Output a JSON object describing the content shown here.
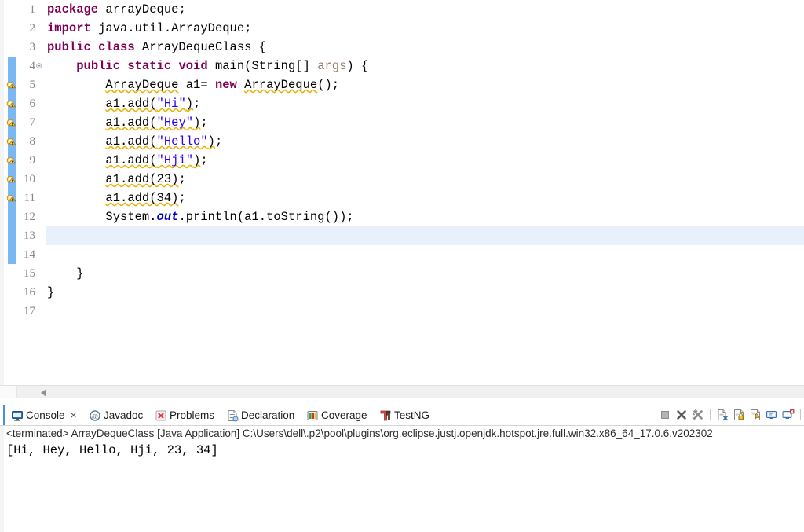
{
  "editor": {
    "name": "java-source-editor",
    "current_line": 13,
    "change_bar_color": "#4da0f0",
    "current_line_highlight": "#e8f0fb",
    "keyword_color": "#7f0055",
    "string_color": "#2a00ff",
    "warning_underline_color": "#e8b000",
    "total_lines": 17,
    "lines": [
      {
        "num": "1",
        "warning": false,
        "fold": false,
        "tokens": [
          {
            "t": "package",
            "c": "kw"
          },
          {
            "t": " arrayDeque;",
            "c": "plain"
          }
        ]
      },
      {
        "num": "2",
        "warning": false,
        "fold": false,
        "tokens": [
          {
            "t": "import",
            "c": "kw"
          },
          {
            "t": " java.util.ArrayDeque;",
            "c": "plain"
          }
        ]
      },
      {
        "num": "3",
        "warning": false,
        "fold": false,
        "tokens": [
          {
            "t": "public class",
            "c": "kw"
          },
          {
            "t": " ArrayDequeClass {",
            "c": "plain"
          }
        ]
      },
      {
        "num": "4",
        "warning": false,
        "fold": true,
        "tokens": [
          {
            "t": "    ",
            "c": "plain"
          },
          {
            "t": "public static void",
            "c": "kw"
          },
          {
            "t": " main(String[] ",
            "c": "plain"
          },
          {
            "t": "args",
            "c": "param"
          },
          {
            "t": ") {",
            "c": "plain"
          }
        ]
      },
      {
        "num": "5",
        "warning": true,
        "fold": false,
        "tokens": [
          {
            "t": "        ",
            "c": "plain"
          },
          {
            "t": "ArrayDeque",
            "c": "plain warnu"
          },
          {
            "t": " a1= ",
            "c": "plain"
          },
          {
            "t": "new",
            "c": "kw"
          },
          {
            "t": " ",
            "c": "plain"
          },
          {
            "t": "ArrayDeque",
            "c": "plain warnu"
          },
          {
            "t": "();",
            "c": "plain"
          }
        ]
      },
      {
        "num": "6",
        "warning": true,
        "fold": false,
        "tokens": [
          {
            "t": "        ",
            "c": "plain"
          },
          {
            "t": "a1.add(",
            "c": "plain warnu"
          },
          {
            "t": "\"Hi\"",
            "c": "str warnu"
          },
          {
            "t": ")",
            "c": "plain warnu"
          },
          {
            "t": ";",
            "c": "plain"
          }
        ]
      },
      {
        "num": "7",
        "warning": true,
        "fold": false,
        "tokens": [
          {
            "t": "        ",
            "c": "plain"
          },
          {
            "t": "a1.add(",
            "c": "plain warnu"
          },
          {
            "t": "\"Hey\"",
            "c": "str warnu"
          },
          {
            "t": ")",
            "c": "plain warnu"
          },
          {
            "t": ";",
            "c": "plain"
          }
        ]
      },
      {
        "num": "8",
        "warning": true,
        "fold": false,
        "tokens": [
          {
            "t": "        ",
            "c": "plain"
          },
          {
            "t": "a1.add(",
            "c": "plain warnu"
          },
          {
            "t": "\"Hello\"",
            "c": "str warnu"
          },
          {
            "t": ")",
            "c": "plain warnu"
          },
          {
            "t": ";",
            "c": "plain"
          }
        ]
      },
      {
        "num": "9",
        "warning": true,
        "fold": false,
        "tokens": [
          {
            "t": "        ",
            "c": "plain"
          },
          {
            "t": "a1.add(",
            "c": "plain warnu"
          },
          {
            "t": "\"Hji\"",
            "c": "str warnu"
          },
          {
            "t": ")",
            "c": "plain warnu"
          },
          {
            "t": ";",
            "c": "plain"
          }
        ]
      },
      {
        "num": "10",
        "warning": true,
        "fold": false,
        "tokens": [
          {
            "t": "        ",
            "c": "plain"
          },
          {
            "t": "a1.add(23)",
            "c": "plain warnu"
          },
          {
            "t": ";",
            "c": "plain"
          }
        ]
      },
      {
        "num": "11",
        "warning": true,
        "fold": false,
        "tokens": [
          {
            "t": "        ",
            "c": "plain"
          },
          {
            "t": "a1.add(34)",
            "c": "plain warnu"
          },
          {
            "t": ";",
            "c": "plain"
          }
        ]
      },
      {
        "num": "12",
        "warning": false,
        "fold": false,
        "tokens": [
          {
            "t": "        System.",
            "c": "plain"
          },
          {
            "t": "out",
            "c": "field"
          },
          {
            "t": ".println(a1.toString());",
            "c": "plain"
          }
        ]
      },
      {
        "num": "13",
        "warning": false,
        "fold": false,
        "current": true,
        "tokens": [
          {
            "t": "        ",
            "c": "plain"
          }
        ]
      },
      {
        "num": "14",
        "warning": false,
        "fold": false,
        "tokens": [
          {
            "t": "",
            "c": "plain"
          }
        ]
      },
      {
        "num": "15",
        "warning": false,
        "fold": false,
        "tokens": [
          {
            "t": "    }",
            "c": "plain"
          }
        ]
      },
      {
        "num": "16",
        "warning": false,
        "fold": false,
        "tokens": [
          {
            "t": "}",
            "c": "plain"
          }
        ]
      },
      {
        "num": "17",
        "warning": false,
        "fold": false,
        "tokens": [
          {
            "t": "",
            "c": "plain"
          }
        ]
      }
    ]
  },
  "console_panel": {
    "tabs": [
      {
        "label": "Console",
        "icon": "console-icon",
        "active": true,
        "closable": true
      },
      {
        "label": "Javadoc",
        "icon": "javadoc-icon",
        "active": false,
        "closable": false
      },
      {
        "label": "Problems",
        "icon": "problems-icon",
        "active": false,
        "closable": false
      },
      {
        "label": "Declaration",
        "icon": "declaration-icon",
        "active": false,
        "closable": false
      },
      {
        "label": "Coverage",
        "icon": "coverage-icon",
        "active": false,
        "closable": false
      },
      {
        "label": "TestNG",
        "icon": "testng-icon",
        "active": false,
        "closable": false
      }
    ],
    "close_glyph": "×",
    "toolbar": [
      {
        "name": "terminate-button",
        "icon": "stop-square-icon"
      },
      {
        "name": "remove-launch-button",
        "icon": "remove-x-icon"
      },
      {
        "name": "remove-all-terminated-button",
        "icon": "remove-all-x-icon"
      },
      {
        "name": "separator-1",
        "icon": "separator"
      },
      {
        "name": "clear-console-button",
        "icon": "clear-console-icon"
      },
      {
        "name": "scroll-lock-button",
        "icon": "scroll-lock-icon"
      },
      {
        "name": "pin-console-button",
        "icon": "pin-console-icon"
      },
      {
        "name": "display-selected-console-button",
        "icon": "display-console-icon"
      },
      {
        "name": "open-console-button",
        "icon": "open-console-icon"
      },
      {
        "name": "separator-2",
        "icon": "separator"
      }
    ],
    "launch_line": "<terminated> ArrayDequeClass [Java Application] C:\\Users\\dell\\.p2\\pool\\plugins\\org.eclipse.justj.openjdk.hotspot.jre.full.win32.x86_64_17.0.6.v202302",
    "output": "[Hi, Hey, Hello, Hji, 23, 34]"
  },
  "scrollbar": {
    "name": "editor-horizontal-scrollbar",
    "left_arrow_glyph": "◀"
  }
}
